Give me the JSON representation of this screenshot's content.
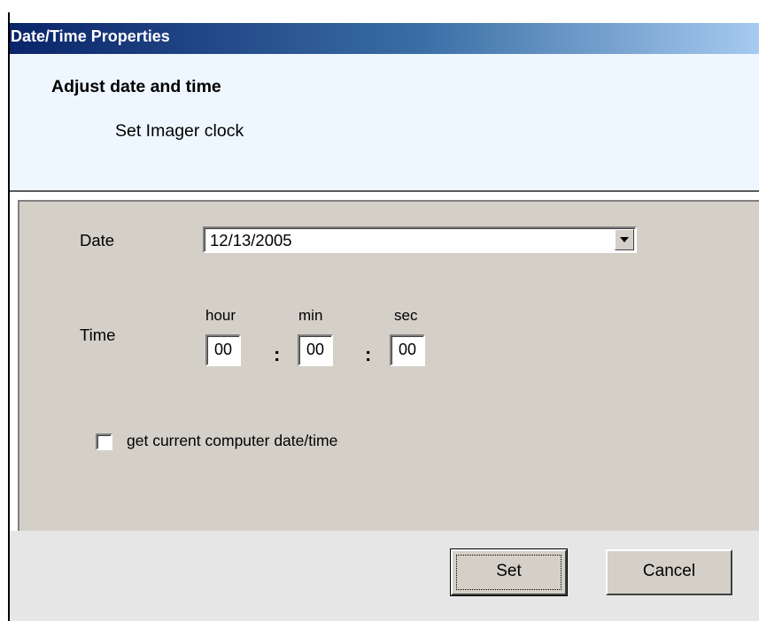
{
  "window": {
    "title": "Date/Time Properties"
  },
  "header": {
    "title": "Adjust date and time",
    "subtitle": "Set Imager clock"
  },
  "form": {
    "date_label": "Date",
    "date_value": "12/13/2005",
    "time_label": "Time",
    "hour_label": "hour",
    "min_label": "min",
    "sec_label": "sec",
    "hour_value": "00",
    "min_value": "00",
    "sec_value": "00",
    "separator": ":",
    "get_current_label": "get current computer date/time",
    "get_current_checked": false
  },
  "footer": {
    "set_label": "Set",
    "cancel_label": "Cancel"
  },
  "colors": {
    "titlebar_start": "#0a246a",
    "titlebar_end": "#a6caf0",
    "header_bg": "#eef7ff",
    "body_bg": "#d4d0c8",
    "footer_bg": "#e6e6e6"
  }
}
